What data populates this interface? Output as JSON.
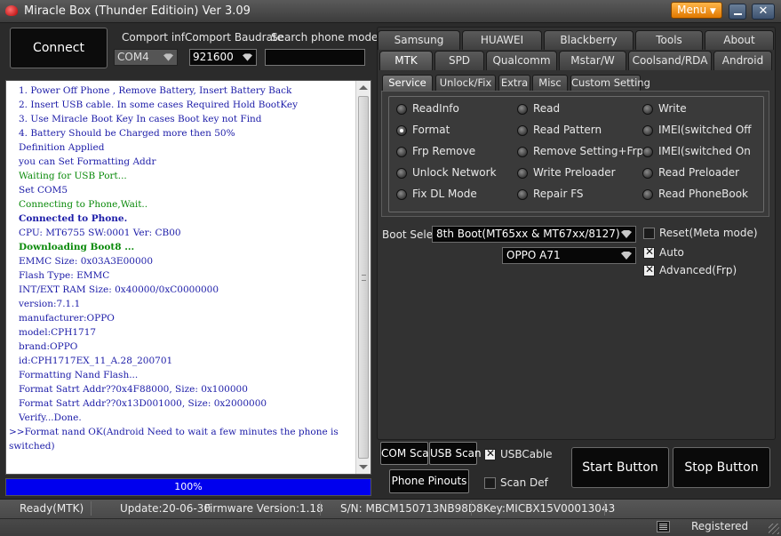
{
  "window": {
    "title": "Miracle Box (Thunder Editioin) Ver 3.09",
    "menu_label": "Menu",
    "close_glyph": "✕"
  },
  "connection": {
    "connect_label": "Connect Button",
    "comport_label": "Comport inf",
    "comport_value": "COM4",
    "baud_label": "Comport Baudrate",
    "baud_value": "921600",
    "search_label": "Search phone model",
    "search_value": ""
  },
  "log": {
    "lines": [
      {
        "text": "1. Power Off Phone , Remove Battery, Insert Battery Back",
        "color": "blue"
      },
      {
        "text": "2. Insert USB cable. In some cases Required Hold BootKey",
        "color": "blue"
      },
      {
        "text": "3. Use Miracle Boot Key In cases Boot key not Find",
        "color": "blue"
      },
      {
        "text": "4. Battery Should be Charged more then 50%",
        "color": "blue"
      },
      {
        "text": "Definition Applied",
        "color": "blue"
      },
      {
        "text": "you can Set Formatting Addr",
        "color": "blue"
      },
      {
        "text": "Waiting for USB Port...",
        "color": "green"
      },
      {
        "text": "Set COM5",
        "color": "blue"
      },
      {
        "text": "Connecting to Phone,Wait..",
        "color": "green"
      },
      {
        "text": "Connected to Phone.",
        "color": "blue",
        "bold": true
      },
      {
        "text": "CPU: MT6755 SW:0001 Ver: CB00",
        "color": "blue"
      },
      {
        "text": "Downloading Boot8 ...",
        "color": "green",
        "bold": true
      },
      {
        "text": "EMMC Size: 0x03A3E00000",
        "color": "blue"
      },
      {
        "text": "Flash Type: EMMC",
        "color": "blue"
      },
      {
        "text": "INT/EXT RAM  Size: 0x40000/0xC0000000",
        "color": "blue"
      },
      {
        "text": "version:7.1.1",
        "color": "blue"
      },
      {
        "text": "manufacturer:OPPO",
        "color": "blue"
      },
      {
        "text": "model:CPH1717",
        "color": "blue"
      },
      {
        "text": "brand:OPPO",
        "color": "blue"
      },
      {
        "text": "id:CPH1717EX_11_A.28_200701",
        "color": "blue"
      },
      {
        "text": "Formatting Nand Flash...",
        "color": "blue"
      },
      {
        "text": "Format Satrt Addr??0x4F88000, Size: 0x100000",
        "color": "blue"
      },
      {
        "text": "Format Satrt Addr??0x13D001000, Size: 0x2000000",
        "color": "blue"
      },
      {
        "text": "Verify...Done.",
        "color": "blue"
      },
      {
        "text": ">>Format nand OK(Android Need to wait a few minutes the phone is switched)",
        "color": "blue",
        "wrap": true
      }
    ]
  },
  "progress": {
    "value": 100,
    "label": "100%"
  },
  "brand_tabs_row1": [
    "Samsung",
    "HUAWEI",
    "Blackberry",
    "Tools",
    "About"
  ],
  "brand_tabs_row2": [
    "MTK",
    "SPD",
    "Qualcomm",
    "Mstar/W",
    "Coolsand/RDA",
    "Android"
  ],
  "active_brand_tab": "MTK",
  "sub_tabs": [
    "Service",
    "Unlock/Fix",
    "Extra",
    "Misc",
    "Custom Setting"
  ],
  "active_sub_tab": "Service",
  "service": {
    "col1": [
      "ReadInfo",
      "Format",
      "Frp Remove",
      "Unlock Network",
      "Fix DL Mode"
    ],
    "col2": [
      "Read",
      "Read Pattern",
      "Remove Setting+Frp",
      "Write Preloader",
      "Repair FS"
    ],
    "col3": [
      "Write",
      "IMEI(switched Off",
      "IMEI(switched On",
      "Read Preloader",
      "Read PhoneBook"
    ],
    "selected": "Format"
  },
  "boot": {
    "label": "Boot Select:",
    "value": "8th Boot(MT65xx & MT67xx/8127)",
    "model_value": "OPPO A71",
    "reset_label": "Reset(Meta mode)",
    "reset_checked": false,
    "auto_label": "Auto",
    "auto_checked": true,
    "advanced_label": "Advanced(Frp)",
    "advanced_checked": true
  },
  "actions": {
    "com_scan": "COM Scan",
    "usb_scan": "USB Scan",
    "usb_cable_label": "USBCable",
    "usb_cable_checked": true,
    "phone_pinouts": "Phone Pinouts",
    "scan_def_label": "Scan Def",
    "scan_def_checked": false,
    "start": "Start Button",
    "stop": "Stop Button"
  },
  "status": {
    "state": "Ready(MTK)",
    "update": "Update:20-06-30",
    "firmware": "Firmware Version:1.18",
    "sn": "S/N: MBCM150713NB98D8",
    "key": "Key:MICBX15V00013043",
    "registered": "Registered"
  }
}
